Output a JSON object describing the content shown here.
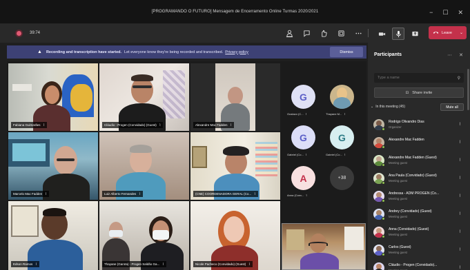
{
  "window": {
    "title": "[PROGRAMANDO O FUTURO] Mensagem de Encerramento Online Turmas 2020/2021",
    "minimize": "−",
    "maximize": "☐",
    "close": "✕"
  },
  "toolbar": {
    "timer": "39:74",
    "leave_label": "Leave"
  },
  "banner": {
    "headline": "Recording and transcription have started.",
    "body": "Let everyone know they're being recorded and transcribed.",
    "policy_link": "Privacy policy",
    "dismiss_label": "Dismiss"
  },
  "tiles": [
    {
      "name": "Fabiana Guimarães"
    },
    {
      "name": "Cláudio - Progen (Convidado) (Guest)"
    },
    {
      "name": "Alexandre Mac Fadden"
    },
    {
      "name": "Marcelo Mac Fadden"
    },
    {
      "name": "Luiz Alberto Fernandes"
    },
    {
      "name": "(CNE) COORDENADORA GERAL (Co..."
    },
    {
      "name": "Edson Ramos"
    },
    {
      "name": "Thayane (Garota) - Progen Saldão Ga..."
    },
    {
      "name": "Nicole Pacheco (Convidado) (Guest)"
    }
  ],
  "avatars": [
    {
      "initial": "G",
      "label": "Gustavo (C..."
    },
    {
      "initial": "",
      "label": "Thayane M..."
    },
    {
      "initial": "G",
      "label": "Gabriel (Co..."
    },
    {
      "initial": "G",
      "label": "Gabriel (Co..."
    },
    {
      "initial": "A",
      "label": "Anna (Conv..."
    },
    {
      "initial": "+38",
      "label": ""
    }
  ],
  "panel": {
    "title": "Participants",
    "search_placeholder": "Type a name",
    "share_invite": "Share invite",
    "section": "In this meeting (45)",
    "mute_all": "Mute all",
    "participants": [
      {
        "name": "Rodrigo Olivandro Dias",
        "role": "Organizer"
      },
      {
        "name": "Alexandre Mac Fadden",
        "role": ""
      },
      {
        "name": "Alexandre Mac Fadden (Guest)",
        "role": "Meeting guest"
      },
      {
        "name": "Ana Paula (Convidado) (Guest)",
        "role": "Meeting guest"
      },
      {
        "name": "Andressa - ADM PROGEN (Co...",
        "role": "Meeting guest"
      },
      {
        "name": "Andrey (Convidado) (Guest)",
        "role": "Meeting guest"
      },
      {
        "name": "Anna (Convidado) (Guest)",
        "role": "Meeting guest"
      },
      {
        "name": "Carlos (Guest)",
        "role": "Meeting guest"
      },
      {
        "name": "Cláudio - Progen (Convidado)...",
        "role": "Meeting guest"
      }
    ]
  },
  "colors": {
    "leave": "#c4314b",
    "banner": "#3d4175",
    "status_available": "#92c353"
  }
}
